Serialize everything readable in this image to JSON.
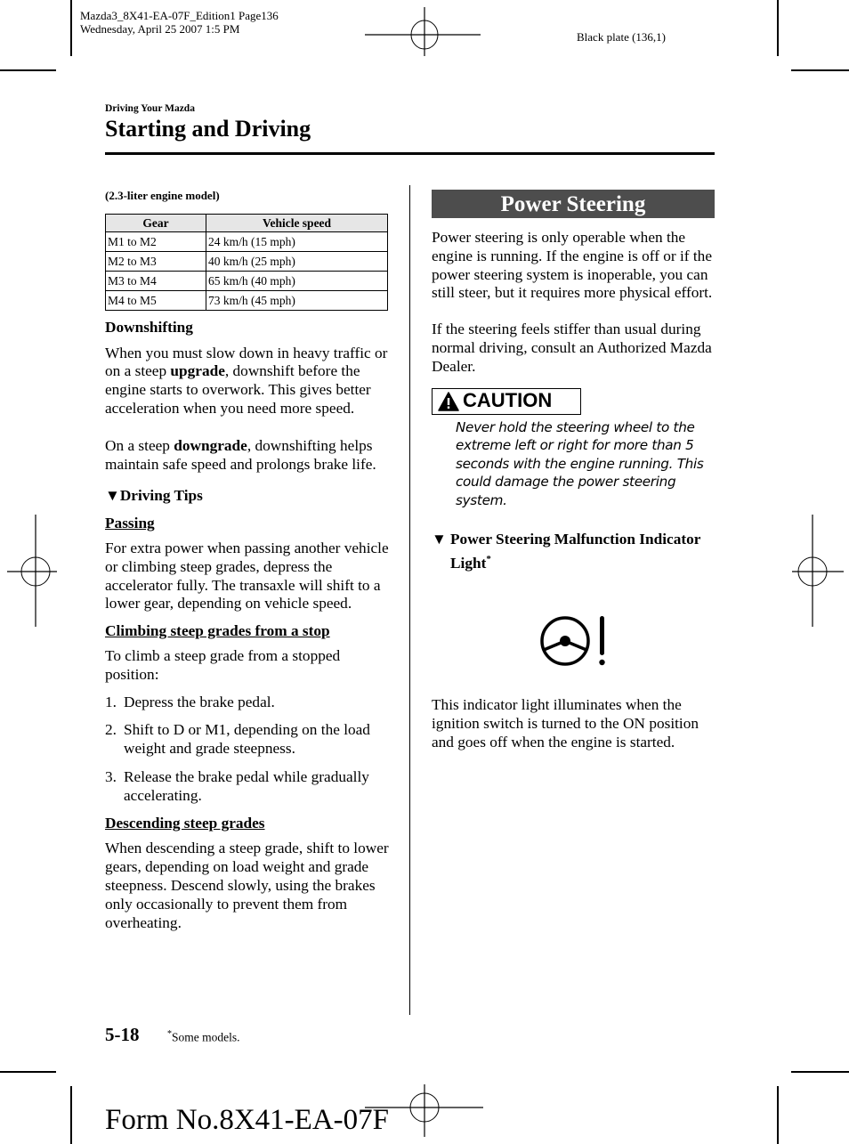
{
  "print_header": {
    "file_line": "Mazda3_8X41-EA-07F_Edition1 Page136",
    "date_line": "Wednesday, April 25 2007 1:5 PM",
    "plate": "Black plate (136,1)"
  },
  "header": {
    "section": "Driving Your Mazda",
    "title": "Starting and Driving"
  },
  "left_column": {
    "table_caption": "(2.3-liter engine model)",
    "table": {
      "headers": [
        "Gear",
        "Vehicle speed"
      ],
      "rows": [
        [
          "M1 to M2",
          "24 km/h (15 mph)"
        ],
        [
          "M2 to M3",
          "40 km/h (25 mph)"
        ],
        [
          "M3 to M4",
          "65 km/h (40 mph)"
        ],
        [
          "M4 to M5",
          "73 km/h (45 mph)"
        ]
      ]
    },
    "downshifting": {
      "heading": "Downshifting",
      "p1": {
        "before": "When you must slow down in heavy traffic or on a steep ",
        "bold": "upgrade",
        "after": ", downshift before the engine starts to overwork. This gives better acceleration when you need more speed."
      },
      "p2": {
        "before": "On a steep ",
        "bold": "downgrade",
        "after": ", downshifting helps maintain safe speed and prolongs brake life."
      }
    },
    "driving_tips": {
      "marker": "▼",
      "heading": "Driving Tips",
      "passing": {
        "heading": "Passing",
        "text": "For extra power when passing another vehicle or climbing steep grades, depress the accelerator fully. The transaxle will shift to a lower gear, depending on vehicle speed."
      },
      "climbing": {
        "heading": "Climbing steep grades from a stop",
        "intro": "To climb a steep grade from a stopped position:",
        "steps": [
          {
            "num": "1.",
            "text": "Depress the brake pedal."
          },
          {
            "num": "2.",
            "text": "Shift to D or M1, depending on the load weight and grade steepness."
          },
          {
            "num": "3.",
            "text": "Release the brake pedal while gradually accelerating."
          }
        ]
      },
      "descending": {
        "heading": "Descending steep grades",
        "text": "When descending a steep grade, shift to lower gears, depending on load weight and grade steepness. Descend slowly, using the brakes only occasionally to prevent them from overheating."
      }
    }
  },
  "right_column": {
    "banner": "Power Steering",
    "p1": "Power steering is only operable when the engine is running. If the engine is off or if the power steering system is inoperable, you can still steer, but it requires more physical effort.",
    "p2": "If the steering feels stiffer than usual during normal driving, consult an Authorized Mazda Dealer.",
    "caution": {
      "icon": "warning-triangle-icon",
      "label": "CAUTION",
      "text": "Never hold the steering wheel to the extreme left or right for more than 5 seconds with the engine running. This could damage the power steering system."
    },
    "indicator_section": {
      "marker": "▼",
      "heading": "Power Steering Malfunction Indicator Light",
      "footnote_mark": "*",
      "icon": "steering-wheel-warning-icon",
      "text": "This indicator light illuminates when the ignition switch is turned to the ON position and goes off when the engine is started."
    }
  },
  "footer": {
    "page_number": "5-18",
    "footnote_mark": "*",
    "footnote": "Some models.",
    "form_number": "Form No.8X41-EA-07F"
  }
}
